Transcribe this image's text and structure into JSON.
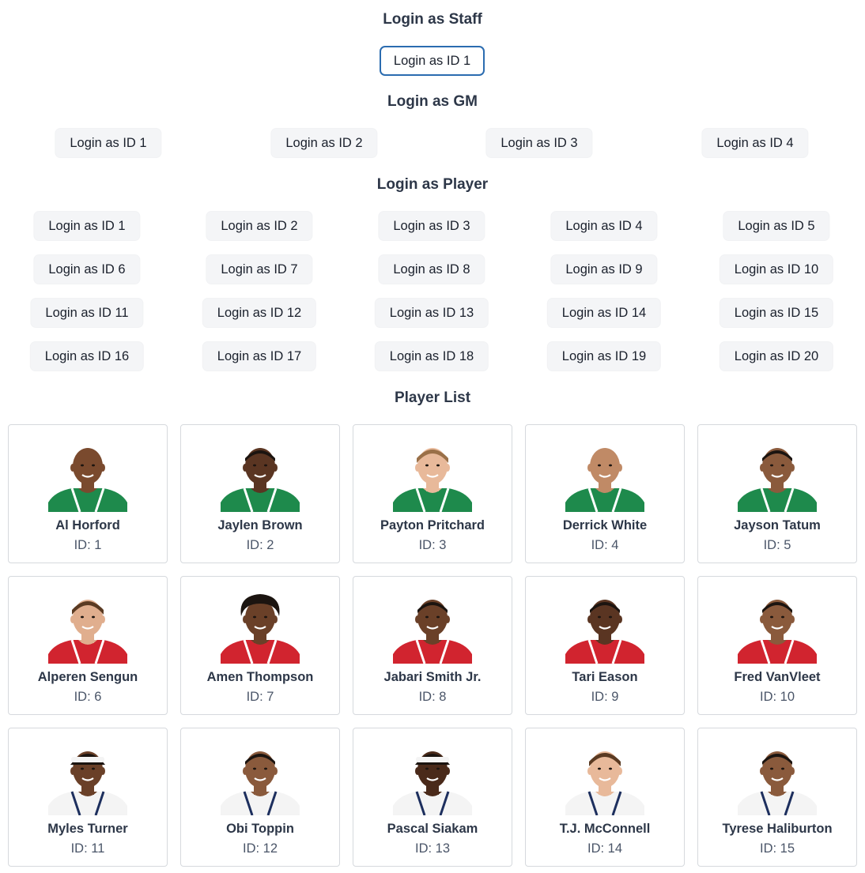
{
  "staff": {
    "heading": "Login as Staff",
    "buttons": [
      "Login as ID 1"
    ]
  },
  "gm": {
    "heading": "Login as GM",
    "buttons": [
      "Login as ID 1",
      "Login as ID 2",
      "Login as ID 3",
      "Login as ID 4"
    ]
  },
  "player_login": {
    "heading": "Login as Player",
    "buttons": [
      "Login as ID 1",
      "Login as ID 2",
      "Login as ID 3",
      "Login as ID 4",
      "Login as ID 5",
      "Login as ID 6",
      "Login as ID 7",
      "Login as ID 8",
      "Login as ID 9",
      "Login as ID 10",
      "Login as ID 11",
      "Login as ID 12",
      "Login as ID 13",
      "Login as ID 14",
      "Login as ID 15",
      "Login as ID 16",
      "Login as ID 17",
      "Login as ID 18",
      "Login as ID 19",
      "Login as ID 20"
    ]
  },
  "player_list": {
    "heading": "Player List",
    "id_prefix": "ID: ",
    "players": [
      {
        "name": "Al Horford",
        "id": "1",
        "team_color": "#1e8a4c",
        "skin": "#7a4a2e",
        "hair": "bald"
      },
      {
        "name": "Jaylen Brown",
        "id": "2",
        "team_color": "#1e8a4c",
        "skin": "#5a3522",
        "hair": "short"
      },
      {
        "name": "Payton Pritchard",
        "id": "3",
        "team_color": "#1e8a4c",
        "skin": "#e8b99a",
        "hair": "short-light"
      },
      {
        "name": "Derrick White",
        "id": "4",
        "team_color": "#1e8a4c",
        "skin": "#c08a66",
        "hair": "bald"
      },
      {
        "name": "Jayson Tatum",
        "id": "5",
        "team_color": "#1e8a4c",
        "skin": "#8a5a3c",
        "hair": "short"
      },
      {
        "name": "Alperen Sengun",
        "id": "6",
        "team_color": "#d1242f",
        "skin": "#e0ae8e",
        "hair": "short-brown"
      },
      {
        "name": "Amen Thompson",
        "id": "7",
        "team_color": "#d1242f",
        "skin": "#6a4028",
        "hair": "curly"
      },
      {
        "name": "Jabari Smith Jr.",
        "id": "8",
        "team_color": "#d1242f",
        "skin": "#6a4028",
        "hair": "short"
      },
      {
        "name": "Tari Eason",
        "id": "9",
        "team_color": "#d1242f",
        "skin": "#5a3522",
        "hair": "short"
      },
      {
        "name": "Fred VanVleet",
        "id": "10",
        "team_color": "#d1242f",
        "skin": "#8a5a3c",
        "hair": "short"
      },
      {
        "name": "Myles Turner",
        "id": "11",
        "team_color": "#f4f4f4",
        "skin": "#6a4028",
        "hair": "headband"
      },
      {
        "name": "Obi Toppin",
        "id": "12",
        "team_color": "#f4f4f4",
        "skin": "#8a5a3c",
        "hair": "short"
      },
      {
        "name": "Pascal Siakam",
        "id": "13",
        "team_color": "#f4f4f4",
        "skin": "#4a2a1a",
        "hair": "headband"
      },
      {
        "name": "T.J. McConnell",
        "id": "14",
        "team_color": "#f4f4f4",
        "skin": "#e8b99a",
        "hair": "short-brown"
      },
      {
        "name": "Tyrese Haliburton",
        "id": "15",
        "team_color": "#f4f4f4",
        "skin": "#8a5a3c",
        "hair": "short"
      }
    ]
  }
}
